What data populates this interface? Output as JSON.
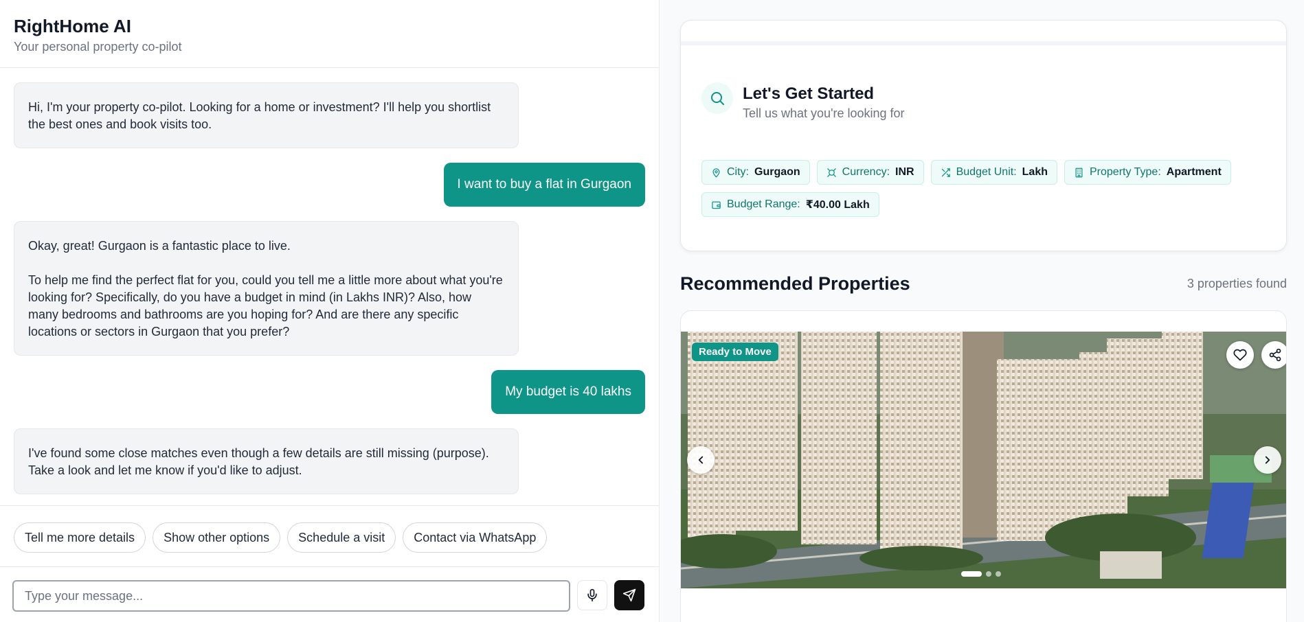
{
  "header": {
    "title": "RightHome AI",
    "subtitle": "Your personal property co-pilot"
  },
  "messages": [
    {
      "role": "assistant",
      "text": "Hi, I'm your property co-pilot. Looking for a home or investment? I'll help you shortlist the best ones and book visits too."
    },
    {
      "role": "user",
      "text": "I want to buy a flat in Gurgaon"
    },
    {
      "role": "assistant",
      "p1": "Okay, great! Gurgaon is a fantastic place to live.",
      "p2": "To help me find the perfect flat for you, could you tell me a little more about what you're looking for? Specifically, do you have a budget in mind (in Lakhs INR)? Also, how many bedrooms and bathrooms are you hoping for? And are there any specific locations or sectors in Gurgaon that you prefer?"
    },
    {
      "role": "user",
      "text": "My budget is 40 lakhs"
    },
    {
      "role": "assistant",
      "text": "I've found some close matches even though a few details are still missing (purpose). Take a look and let me know if you'd like to adjust."
    }
  ],
  "suggestions": [
    "Tell me more details",
    "Show other options",
    "Schedule a visit",
    "Contact via WhatsApp"
  ],
  "composer": {
    "placeholder": "Type your message...",
    "mic_icon": "microphone-icon",
    "send_icon": "send-icon"
  },
  "start": {
    "title": "Let's Get Started",
    "subtitle": "Tell us what you're looking for",
    "filters": [
      {
        "icon": "map-pin-icon",
        "label": "City:",
        "value": "Gurgaon"
      },
      {
        "icon": "currency-icon",
        "label": "Currency:",
        "value": "INR"
      },
      {
        "icon": "shuffle-icon",
        "label": "Budget Unit:",
        "value": "Lakh"
      },
      {
        "icon": "building-icon",
        "label": "Property Type:",
        "value": "Apartment"
      },
      {
        "icon": "wallet-icon",
        "label": "Budget Range:",
        "value": "₹40.00 Lakh"
      }
    ]
  },
  "recommended": {
    "title": "Recommended Properties",
    "count": "3 properties found"
  },
  "property": {
    "badge": "Ready to Move",
    "image_count": 3,
    "active_image": 1
  },
  "colors": {
    "accent": "#0f9488",
    "chip_bg": "#effbf8",
    "bubble_ai": "#f3f4f6"
  }
}
